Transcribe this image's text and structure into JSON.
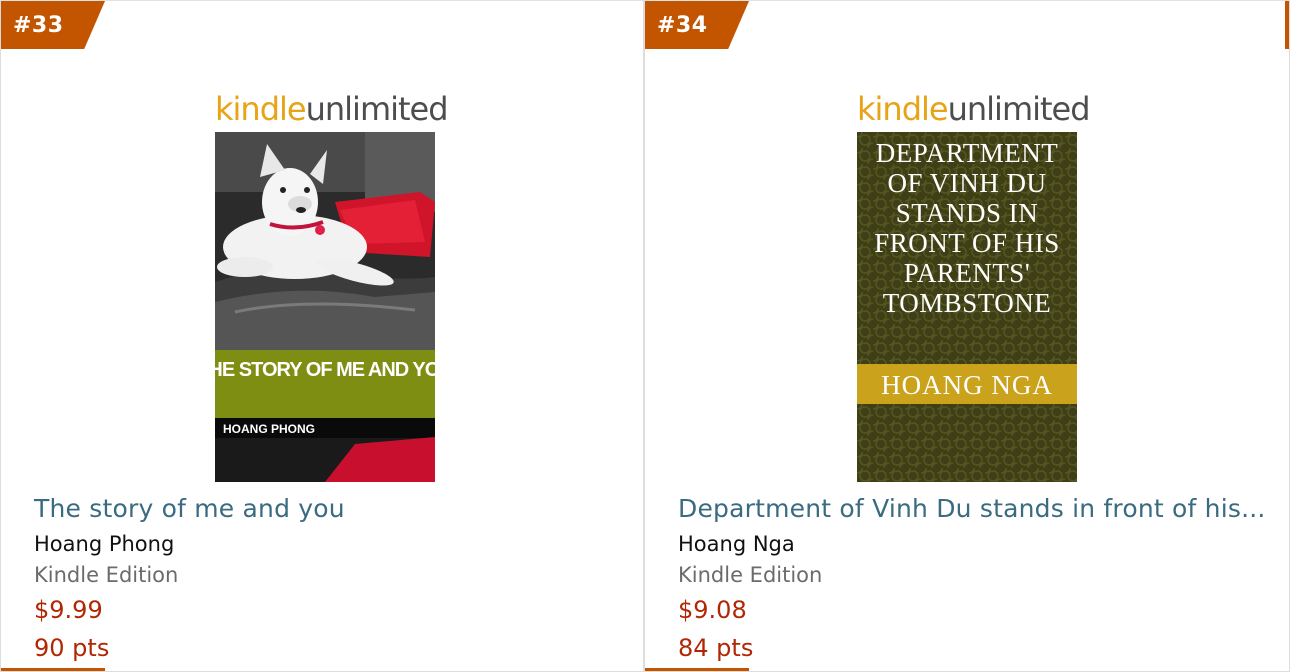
{
  "colors": {
    "rank_badge": "#c45500",
    "title_link": "#3b6b80",
    "price": "#b12704",
    "kindle_logo_orange": "#e8a317"
  },
  "products": [
    {
      "rank": "#33",
      "ku_logo": {
        "kindle": "kindle",
        "unlimited": "unlimited"
      },
      "cover": {
        "title_text": "THE STORY OF ME AND YOU",
        "author_text": "HOANG PHONG",
        "image": "dog-on-couch-photo"
      },
      "title": "The story of me and you",
      "author": "Hoang Phong",
      "format": "Kindle Edition",
      "price": "$9.99",
      "points": "90 pts"
    },
    {
      "rank": "#34",
      "ku_logo": {
        "kindle": "kindle",
        "unlimited": "unlimited"
      },
      "cover": {
        "title_lines": [
          "DEPARTMENT",
          "OF VINH DU",
          "STANDS IN",
          "FRONT OF HIS",
          "PARENTS'",
          "TOMBSTONE"
        ],
        "author_text": "HOANG NGA",
        "image": "olive-pattern-background"
      },
      "title": "Department of Vinh Du stands in front of his...",
      "author": "Hoang Nga",
      "format": "Kindle Edition",
      "price": "$9.08",
      "points": "84 pts"
    }
  ]
}
